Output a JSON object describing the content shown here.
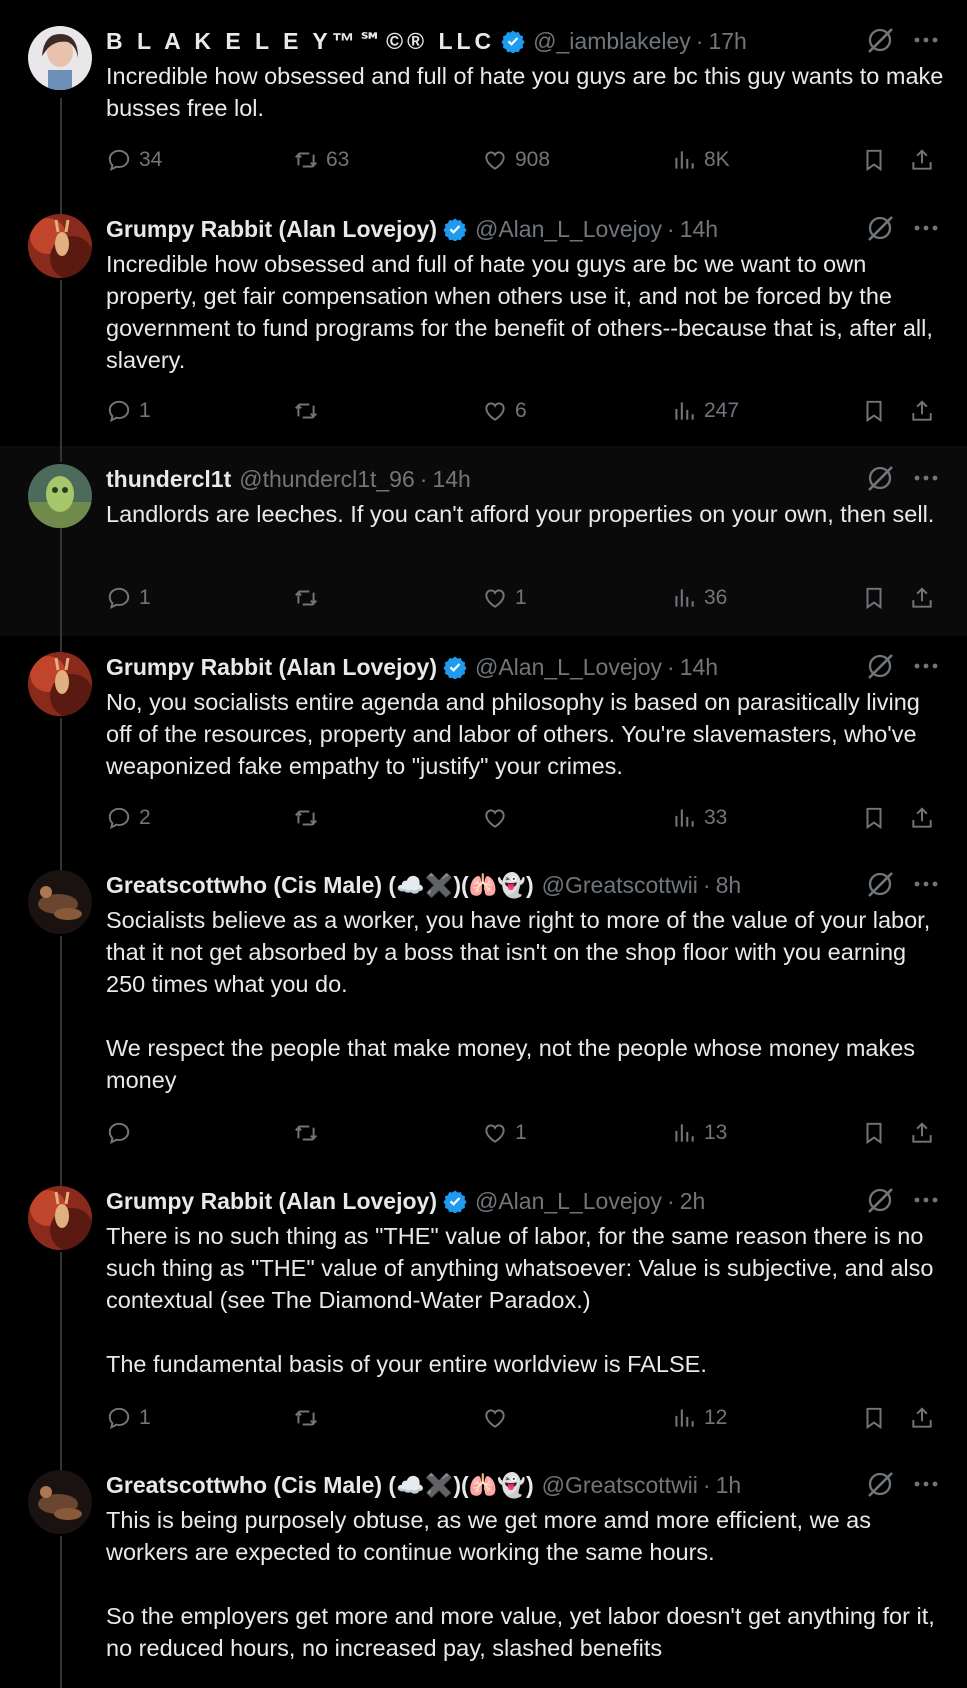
{
  "tweets": [
    {
      "name": "B L A K E L E Y™℠©® LLC",
      "verified": true,
      "handle": "@_iamblakeley",
      "time": "17h",
      "text": "Incredible how obsessed and full of hate you guys are bc this guy wants to make busses free lol.",
      "replies": "34",
      "retweets": "63",
      "likes": "908",
      "views": "8K",
      "avatar": "woman-avatar"
    },
    {
      "name": "Grumpy Rabbit (Alan Lovejoy)",
      "verified": true,
      "handle": "@Alan_L_Lovejoy",
      "time": "14h",
      "text": "Incredible how obsessed and full of hate you guys are bc we want to own property, get fair compensation when others use it, and not be forced by the government to fund programs for the benefit of others--because that is, after all, slavery.",
      "replies": "1",
      "retweets": "",
      "likes": "6",
      "views": "247",
      "avatar": "rabbit-avatar"
    },
    {
      "name": "thundercl1t",
      "verified": false,
      "handle": "@thundercl1t_96",
      "time": "14h",
      "text": "Landlords are leeches. If you can't afford your properties on your own, then sell.",
      "replies": "1",
      "retweets": "",
      "likes": "1",
      "views": "36",
      "avatar": "green-avatar"
    },
    {
      "name": "Grumpy Rabbit (Alan Lovejoy)",
      "verified": true,
      "handle": "@Alan_L_Lovejoy",
      "time": "14h",
      "text": "No, you socialists entire agenda and philosophy is based on parasitically living off of the resources, property and labor of others. You're slavemasters, who've weaponized fake empathy to \"justify\" your crimes.",
      "replies": "2",
      "retweets": "",
      "likes": "",
      "views": "33",
      "avatar": "rabbit-avatar"
    },
    {
      "name": "Greatscottwho (Cis Male) (☁️✖️)(🫁👻)",
      "verified": false,
      "handle": "@Greatscottwii",
      "time": "8h",
      "text": "Socialists believe as a worker, you have right to more of the value of your labor, that it not get absorbed by a boss that isn't on the shop floor with you earning 250 times what you do.\n\nWe respect the people that make money, not the people whose money makes money",
      "replies": "",
      "retweets": "",
      "likes": "1",
      "views": "13",
      "avatar": "dark-avatar"
    },
    {
      "name": "Grumpy Rabbit (Alan Lovejoy)",
      "verified": true,
      "handle": "@Alan_L_Lovejoy",
      "time": "2h",
      "text": "There is no such thing as \"THE\" value of labor, for the same reason there is no such thing as \"THE\" value of anything whatsoever: Value is subjective, and also contextual (see The Diamond-Water Paradox.)\n\nThe fundamental basis of your entire worldview is FALSE.",
      "replies": "1",
      "retweets": "",
      "likes": "",
      "views": "12",
      "avatar": "rabbit-avatar"
    },
    {
      "name": "Greatscottwho (Cis Male) (☁️✖️)(🫁👻)",
      "verified": false,
      "handle": "@Greatscottwii",
      "time": "1h",
      "text": "This is being purposely obtuse, as we get more amd more efficient, we as workers are expected to continue working the same hours.\n\nSo the employers get more and more value, yet labor doesn't get anything for it, no reduced hours, no increased pay, slashed benefits",
      "replies": "",
      "retweets": "",
      "likes": "",
      "views": "",
      "avatar": "dark-avatar"
    }
  ],
  "colors": {
    "accent": "#1d9bf0",
    "muted": "#71767b",
    "text": "#e7e9ea",
    "background": "#000000"
  }
}
